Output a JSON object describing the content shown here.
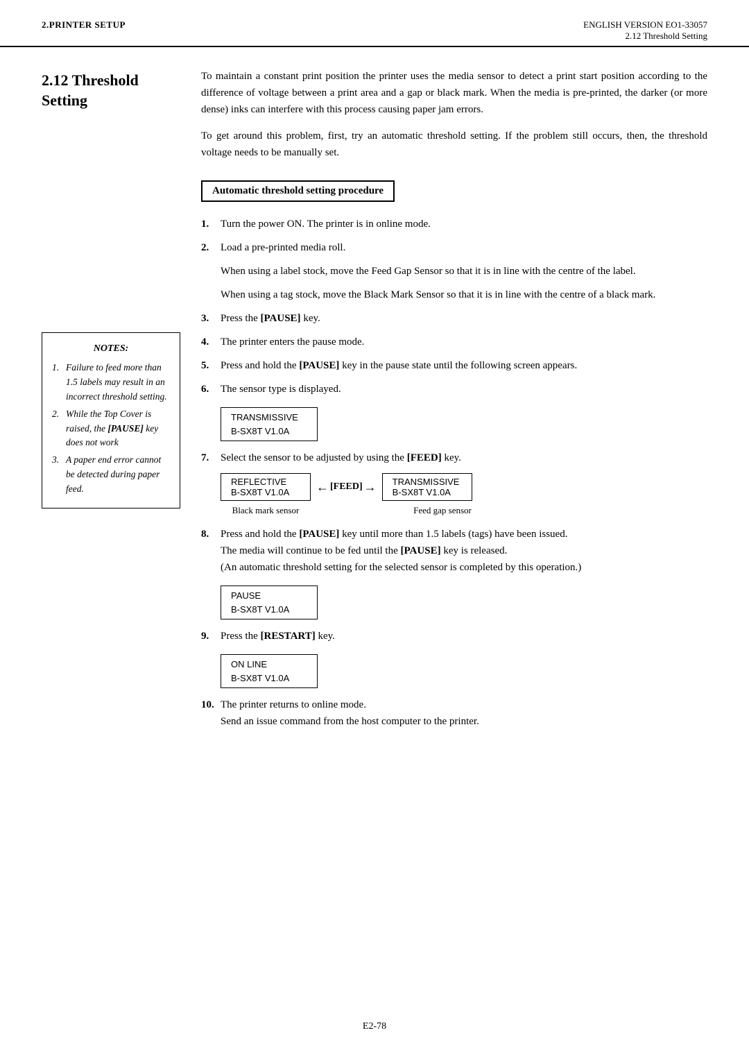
{
  "header": {
    "left": "2.PRINTER SETUP",
    "right_top": "ENGLISH VERSION EO1-33057",
    "right_bottom": "2.12 Threshold Setting"
  },
  "section": {
    "number": "2.12",
    "title": "Threshold Setting"
  },
  "intro": {
    "para1": "To maintain a constant print position the printer uses the media sensor to detect a print start position according to the difference of voltage between a print area and a gap or black mark.  When the media is pre-printed, the darker (or more dense) inks can interfere with this process causing paper jam errors.",
    "para2": "To get around this problem, first, try an automatic threshold setting. If the problem still occurs, then, the threshold voltage needs to be manually set."
  },
  "boxed_heading": "Automatic threshold setting procedure",
  "steps": [
    {
      "num": "1.",
      "text": "Turn the power ON.  The printer is in online mode."
    },
    {
      "num": "2.",
      "text": "Load a pre-printed media roll."
    },
    {
      "sub1": "When using a label stock, move the Feed Gap Sensor so that it is in line with the centre of the label.",
      "sub2": "When using a tag stock, move the Black Mark Sensor so that it is in line with the centre of a black mark."
    },
    {
      "num": "3.",
      "text_pre": "Press the ",
      "bold": "[PAUSE]",
      "text_post": " key."
    },
    {
      "num": "4.",
      "text": "The printer enters the pause mode."
    },
    {
      "num": "5.",
      "text_pre": "Press and hold the ",
      "bold": "[PAUSE]",
      "text_post": " key in the pause state until the following screen appears."
    },
    {
      "num": "6.",
      "text": "The sensor type is displayed."
    },
    {
      "num": "7.",
      "text_pre": "Select the sensor to be adjusted by using the ",
      "bold": "[FEED]",
      "text_post": " key."
    },
    {
      "num": "8.",
      "text_pre": "Press and hold the ",
      "bold1": "[PAUSE]",
      "text_mid": " key until more than 1.5 labels (tags) have been issued.",
      "text_cont": "The media will continue to be fed until the ",
      "bold2": "[PAUSE]",
      "text_end": " key is released.",
      "text_paren": "(An automatic threshold setting for the selected sensor is completed by this operation.)"
    },
    {
      "num": "9.",
      "text_pre": "Press the ",
      "bold": "[RESTART]",
      "text_post": " key."
    },
    {
      "num": "10.",
      "text1": "The printer returns to online mode.",
      "text2": "Send an issue command from the host computer to the printer."
    }
  ],
  "screen6": {
    "line1": "TRANSMISSIVE",
    "line2": "B-SX8T    V1.0A"
  },
  "feed_diagram": {
    "left_box_line1": "REFLECTIVE",
    "left_box_line2": "B-SX8T    V1.0A",
    "arrow_label": "[FEED]",
    "right_box_line1": "TRANSMISSIVE",
    "right_box_line2": "B-SX8T    V1.0A",
    "label_left": "Black mark sensor",
    "label_right": "Feed gap sensor"
  },
  "screen8": {
    "line1": "PAUSE",
    "line2": "B-SX8T    V1.0A"
  },
  "screen9": {
    "line1": "ON LINE",
    "line2": "B-SX8T    V1.0A"
  },
  "notes": {
    "title": "NOTES:",
    "items": [
      "Failure to feed more than 1.5 labels may result in an incorrect threshold setting.",
      "While the Top Cover is raised, the [PAUSE] key does not work",
      "A paper end error cannot be detected during paper feed."
    ]
  },
  "footer": {
    "page": "E2-78"
  }
}
